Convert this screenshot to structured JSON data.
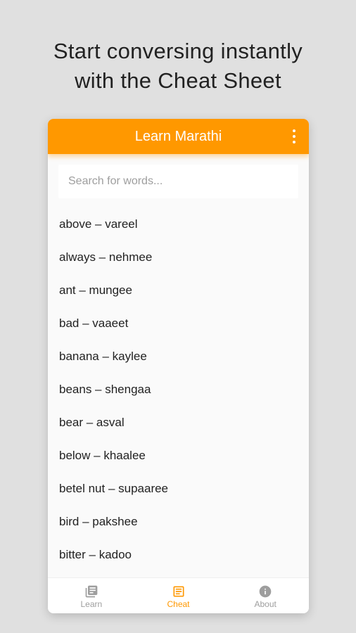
{
  "headline": {
    "line1": "Start conversing instantly",
    "line2": "with the Cheat Sheet"
  },
  "appbar": {
    "title": "Learn Marathi",
    "menu_icon": "more-vert-icon"
  },
  "search": {
    "placeholder": "Search for words...",
    "value": ""
  },
  "words": [
    "above – vareel",
    "always – nehmee",
    "ant – mungee",
    "bad – vaaeet",
    "banana – kaylee",
    "beans – shengaa",
    "bear – asval",
    "below – khaalee",
    "betel nut – supaaree",
    "bird – pakshee",
    "bitter – kadoo"
  ],
  "bottom_nav": [
    {
      "label": "Learn",
      "icon": "library-books-icon",
      "active": false
    },
    {
      "label": "Cheat",
      "icon": "cheat-sheet-icon",
      "active": true
    },
    {
      "label": "About",
      "icon": "info-icon",
      "active": false
    }
  ],
  "colors": {
    "accent": "#ff9800",
    "background": "#e0e0e0",
    "inactive": "#9e9e9e"
  }
}
